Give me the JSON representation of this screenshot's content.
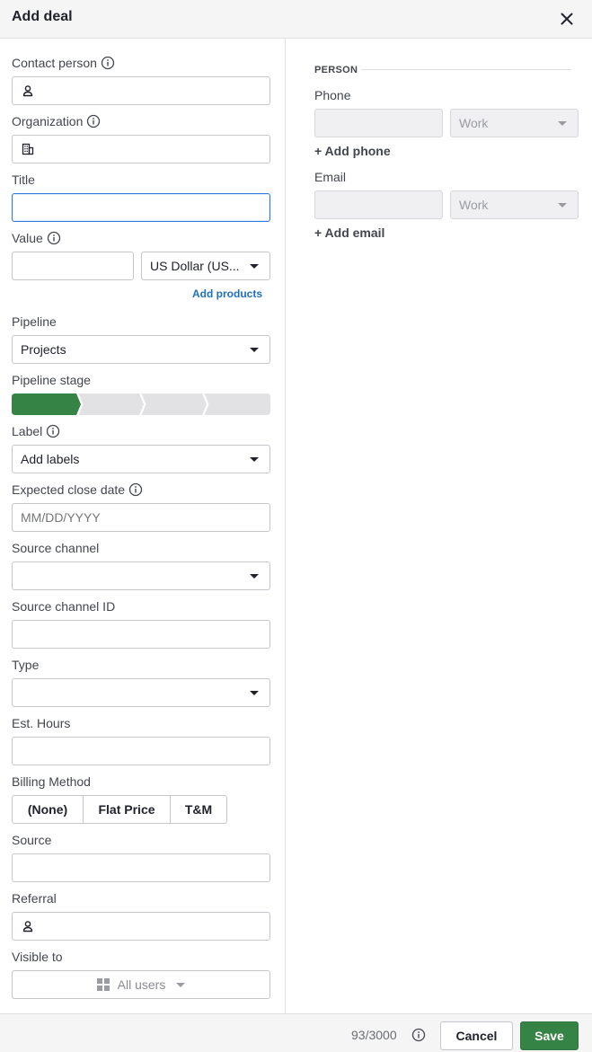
{
  "header": {
    "title": "Add deal",
    "close_icon": "close-icon"
  },
  "form": {
    "contact_person": {
      "label": "Contact person",
      "value": ""
    },
    "organization": {
      "label": "Organization",
      "value": ""
    },
    "title": {
      "label": "Title",
      "value": ""
    },
    "value": {
      "label": "Value",
      "amount": "",
      "currency": "US Dollar (US..."
    },
    "add_products": "Add products",
    "pipeline": {
      "label": "Pipeline",
      "value": "Projects"
    },
    "pipeline_stage": {
      "label": "Pipeline stage",
      "total_stages": 4,
      "current_stage": 1
    },
    "label": {
      "label": "Label",
      "value": "Add labels"
    },
    "expected_close_date": {
      "label": "Expected close date",
      "placeholder": "MM/DD/YYYY"
    },
    "source_channel": {
      "label": "Source channel",
      "value": ""
    },
    "source_channel_id": {
      "label": "Source channel ID",
      "value": ""
    },
    "type": {
      "label": "Type",
      "value": ""
    },
    "est_hours": {
      "label": "Est. Hours",
      "value": ""
    },
    "billing_method": {
      "label": "Billing Method",
      "options": [
        "(None)",
        "Flat Price",
        "T&M"
      ]
    },
    "source": {
      "label": "Source",
      "value": ""
    },
    "referral": {
      "label": "Referral",
      "value": ""
    },
    "visible_to": {
      "label": "Visible to",
      "value": "All users"
    }
  },
  "person": {
    "section_title": "PERSON",
    "phone": {
      "label": "Phone",
      "type": "Work",
      "add": "+ Add phone"
    },
    "email": {
      "label": "Email",
      "type": "Work",
      "add": "+ Add email"
    }
  },
  "footer": {
    "counter": "93/3000",
    "cancel": "Cancel",
    "save": "Save"
  },
  "colors": {
    "accent_green": "#368346",
    "focus_blue": "#317ae2",
    "link_blue": "#1f6fc2"
  }
}
